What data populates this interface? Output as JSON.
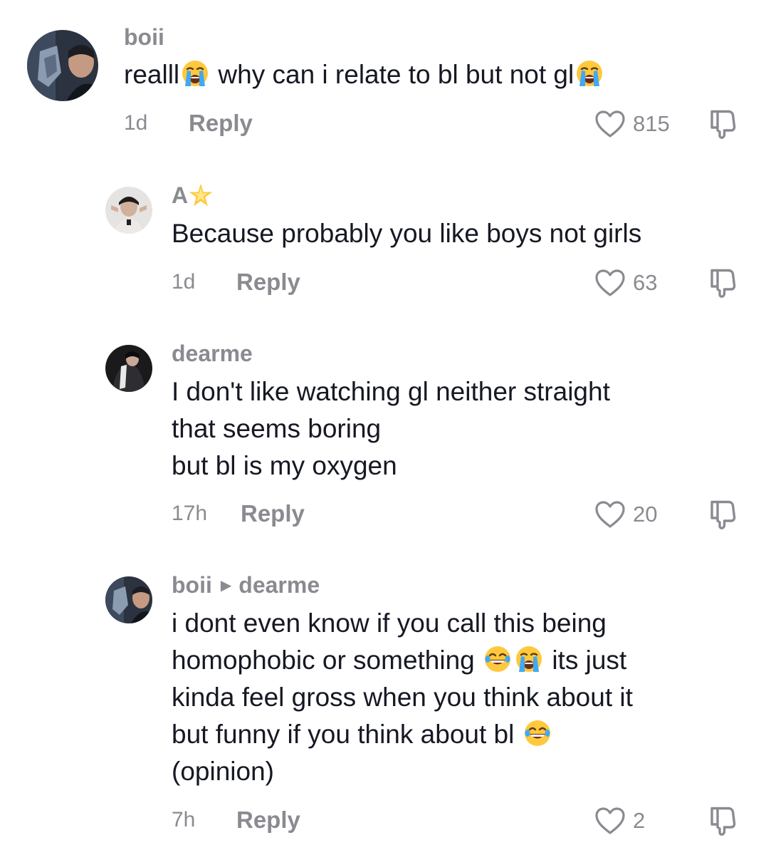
{
  "comments": [
    {
      "username": "boii",
      "text_lines": [
        "realll",
        "why can i relate to bl but not gl"
      ],
      "time": "1d",
      "reply_label": "Reply",
      "likes": "815"
    },
    {
      "username": "A",
      "text_lines": [
        "Because probably you like boys not girls"
      ],
      "time": "1d",
      "reply_label": "Reply",
      "likes": "63"
    },
    {
      "username": "dearme",
      "text_lines": [
        "I don't like watching gl neither straight",
        "that seems boring",
        "but bl is my oxygen"
      ],
      "time": "17h",
      "reply_label": "Reply",
      "likes": "20"
    },
    {
      "username": "boii",
      "reply_to": "dearme",
      "text_lines": [
        "i dont even know if you call this being",
        "homophobic or something",
        "its just",
        "kinda feel gross when you think about it",
        "but funny if you think about bl",
        "(opinion)"
      ],
      "time": "7h",
      "reply_label": "Reply",
      "likes": "2"
    }
  ],
  "icons": {
    "like": "heart-outline-icon",
    "dislike": "thumbs-down-outline-icon",
    "crying_emoji": "loudly-crying-face-emoji",
    "laughing_emoji": "face-with-tears-of-joy-emoji",
    "star_emoji": "glowing-star-emoji",
    "reply_arrow": "triangle-right-icon"
  },
  "colors": {
    "text": "#161823",
    "muted": "#8a8b91",
    "background": "#ffffff"
  }
}
